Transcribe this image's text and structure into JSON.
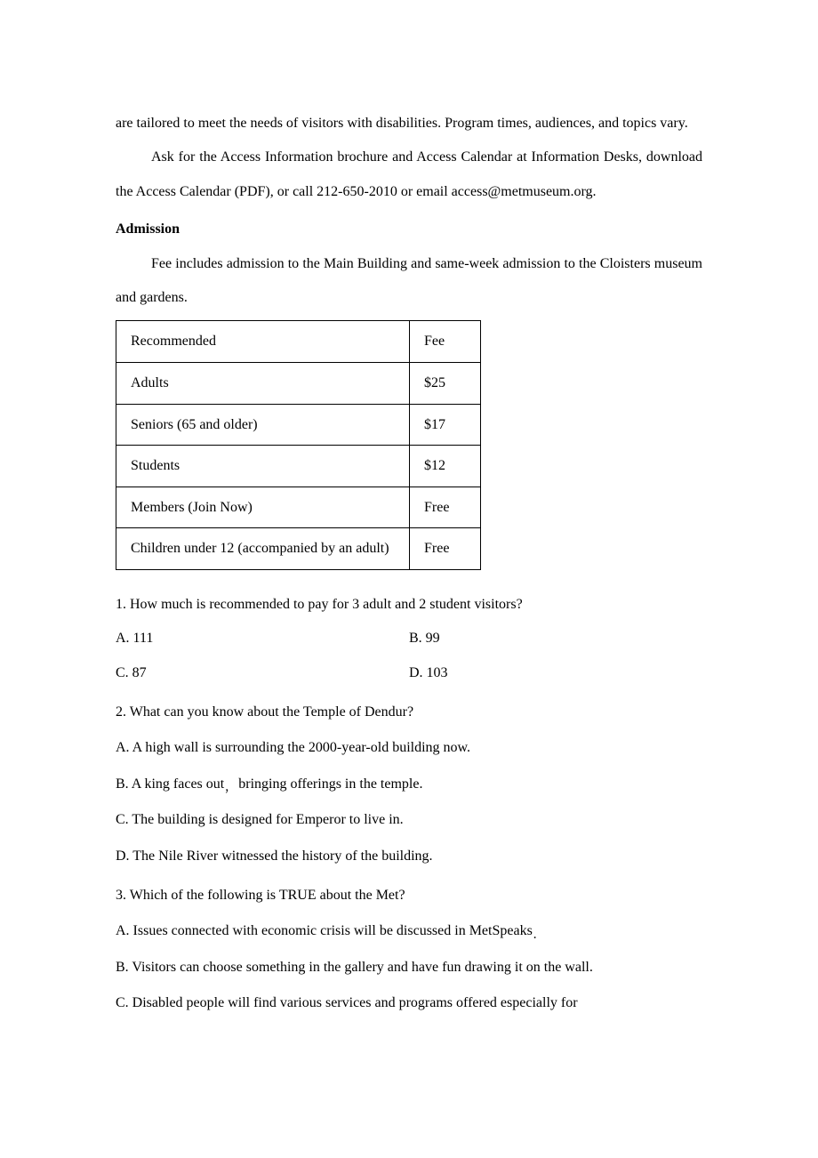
{
  "intro": {
    "p1": "are tailored to meet the needs of visitors with disabilities. Program times, audiences, and topics vary.",
    "p2": "Ask for the Access Information brochure and Access Calendar at Information Desks, download the Access Calendar  (PDF), or call 212-650-2010 or email access@metmuseum.org."
  },
  "admission": {
    "title": "Admission",
    "desc": "Fee includes admission to the Main Building and same-week admission to  the Cloisters museum and gardens.",
    "table": {
      "rows": [
        {
          "label": "Recommended",
          "fee": "Fee"
        },
        {
          "label": "Adults",
          "fee": "$25"
        },
        {
          "label": "Seniors (65 and older)",
          "fee": "$17"
        },
        {
          "label": "Students",
          "fee": "$12"
        },
        {
          "label": "Members (Join Now)",
          "fee": "Free"
        },
        {
          "label": "Children under 12 (accompanied by an adult)",
          "fee": "Free"
        }
      ]
    }
  },
  "questions": {
    "q1": {
      "stem": "1. How much is recommended to pay for 3 adult and 2 student visitors?",
      "a": "A. 111",
      "b": "B. 99",
      "c": "C. 87",
      "d": "D. 103"
    },
    "q2": {
      "stem": "2. What can you know about the Temple of Dendur?",
      "a": "A. A high wall is surrounding the 2000-year-old building now.",
      "b_pre": "B. A king faces out",
      "b_post": " bringing offerings in the temple.",
      "c": "C. The building is designed for Emperor to live in.",
      "d": "D. The Nile River witnessed the history of the building."
    },
    "q3": {
      "stem": "3. Which of the following is TRUE about the Met?",
      "a_pre": "A. Issues connected with economic crisis will be discussed in MetSpeaks",
      "b": "B. Visitors can choose something in the gallery and have fun drawing it on the wall.",
      "c": "C. Disabled people will find various services and programs offered especially for"
    }
  }
}
